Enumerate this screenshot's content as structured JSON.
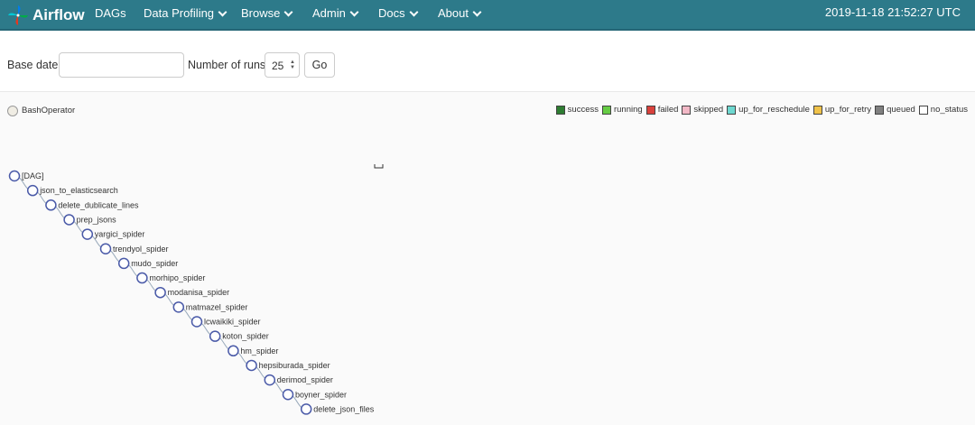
{
  "navbar": {
    "brand": "Airflow",
    "items": [
      {
        "label": "DAGs",
        "dropdown": false
      },
      {
        "label": "Data Profiling",
        "dropdown": true
      },
      {
        "label": "Browse",
        "dropdown": true
      },
      {
        "label": "Admin",
        "dropdown": true
      },
      {
        "label": "Docs",
        "dropdown": true
      },
      {
        "label": "About",
        "dropdown": true
      }
    ],
    "datetime": "2019-11-18 21:52:27 UTC"
  },
  "form": {
    "base_date_label": "Base date:",
    "base_date_value": "",
    "runs_label": "Number of runs:",
    "runs_value": "25",
    "go_label": "Go"
  },
  "operators": [
    {
      "label": "BashOperator"
    }
  ],
  "legend": [
    {
      "label": "success",
      "color": "#2e7d32"
    },
    {
      "label": "running",
      "color": "#66cc44"
    },
    {
      "label": "failed",
      "color": "#d9413c"
    },
    {
      "label": "skipped",
      "color": "#f2b8c6"
    },
    {
      "label": "up_for_reschedule",
      "color": "#6ed8d0"
    },
    {
      "label": "up_for_retry",
      "color": "#f0c24a"
    },
    {
      "label": "queued",
      "color": "#808080"
    },
    {
      "label": "no_status",
      "color": "#ffffff"
    }
  ],
  "tree": {
    "nodes": [
      "[DAG]",
      "json_to_elasticsearch",
      "delete_dublicate_lines",
      "prep_jsons",
      "yargici_spider",
      "trendyol_spider",
      "mudo_spider",
      "morhipo_spider",
      "modanisa_spider",
      "matmazel_spider",
      "lcwaikiki_spider",
      "koton_spider",
      "hm_spider",
      "hepsiburada_spider",
      "derimod_spider",
      "boyner_spider",
      "delete_json_files"
    ]
  }
}
